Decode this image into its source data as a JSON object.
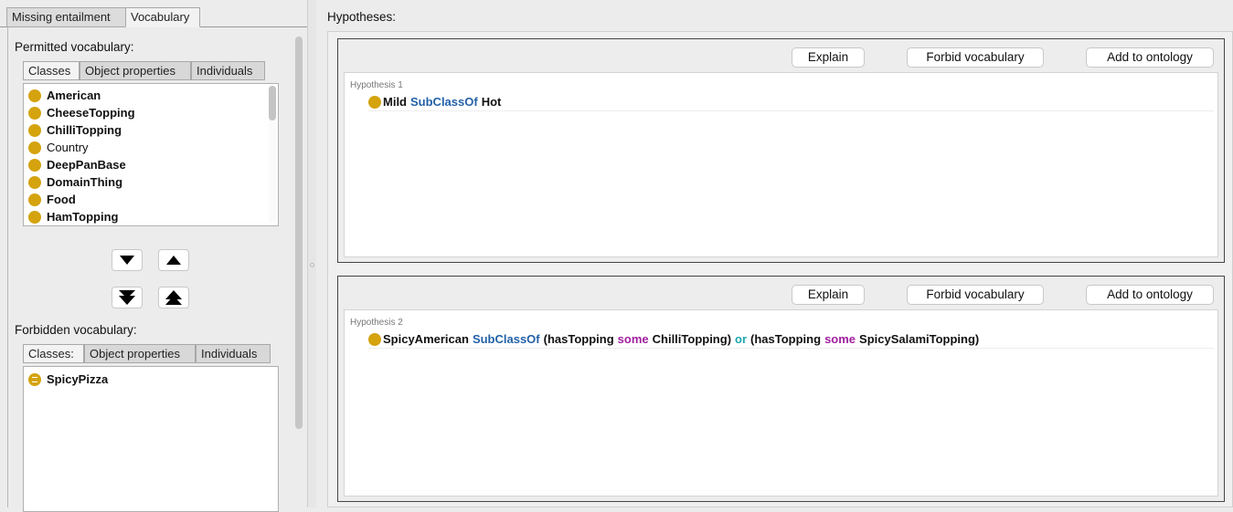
{
  "left_panel": {
    "tabs": [
      "Missing entailment",
      "Vocabulary"
    ],
    "permitted": {
      "title": "Permitted vocabulary:",
      "tabs": [
        "Classes",
        "Object properties",
        "Individuals"
      ],
      "items": [
        {
          "label": "American",
          "bold": true
        },
        {
          "label": "CheeseTopping",
          "bold": true
        },
        {
          "label": "ChilliTopping",
          "bold": true
        },
        {
          "label": "Country",
          "bold": false
        },
        {
          "label": "DeepPanBase",
          "bold": true
        },
        {
          "label": "DomainThing",
          "bold": true
        },
        {
          "label": "Food",
          "bold": true
        },
        {
          "label": "HamTopping",
          "bold": true
        }
      ]
    },
    "forbidden": {
      "title": "Forbidden vocabulary:",
      "tabs": [
        "Classes:",
        "Object properties",
        "Individuals"
      ],
      "items": [
        {
          "label": "SpicyPizza",
          "bold": true
        }
      ]
    },
    "arrow_icons": [
      "move-down-icon",
      "move-up-icon",
      "move-all-down-icon",
      "move-all-up-icon"
    ]
  },
  "hypotheses": {
    "title": "Hypotheses:",
    "buttons": {
      "explain": "Explain",
      "forbid": "Forbid vocabulary",
      "add": "Add to ontology"
    },
    "items": [
      {
        "label": "Hypothesis 1",
        "tokens": [
          {
            "text": "Mild",
            "kind": "plain"
          },
          {
            "text": "SubClassOf",
            "kind": "sub"
          },
          {
            "text": "Hot",
            "kind": "plain"
          }
        ]
      },
      {
        "label": "Hypothesis 2",
        "tokens": [
          {
            "text": "SpicyAmerican",
            "kind": "plain"
          },
          {
            "text": "SubClassOf",
            "kind": "sub"
          },
          {
            "text": "(hasTopping",
            "kind": "plain"
          },
          {
            "text": "some",
            "kind": "some"
          },
          {
            "text": "ChilliTopping)",
            "kind": "plain"
          },
          {
            "text": "or",
            "kind": "or"
          },
          {
            "text": "(hasTopping",
            "kind": "plain"
          },
          {
            "text": "some",
            "kind": "some"
          },
          {
            "text": "SpicySalamiTopping)",
            "kind": "plain"
          }
        ]
      }
    ]
  },
  "colors": {
    "class_dot": "#d4a30e",
    "subclassof": "#2361a8",
    "some": "#a020a0",
    "or": "#1aa5ad"
  }
}
